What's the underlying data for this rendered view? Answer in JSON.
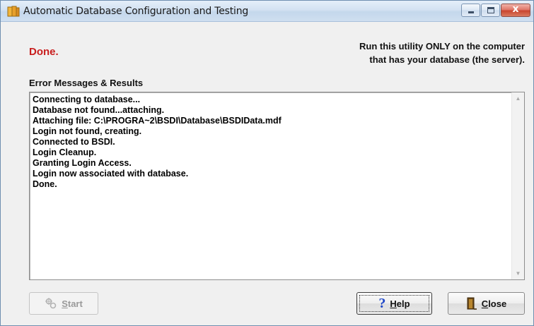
{
  "window": {
    "title": "Automatic Database Configuration and Testing",
    "icons": [
      "app-icon",
      "minimize-icon",
      "maximize-icon",
      "close-icon"
    ],
    "close_glyph": "x"
  },
  "status": {
    "text": "Done.",
    "color": "#c81e1e"
  },
  "notice": {
    "line1": "Run this utility ONLY on the computer",
    "line2": "that has your database (the server)."
  },
  "results": {
    "label": "Error Messages & Results",
    "lines": [
      "Connecting to database...",
      "Database not found...attaching.",
      "Attaching file: C:\\PROGRA~2\\BSDI\\Database\\BSDIData.mdf",
      "Login not found, creating.",
      "Connected to BSDI.",
      "Login Cleanup.",
      "Granting Login Access.",
      "Login now associated with database.",
      "Done."
    ]
  },
  "buttons": {
    "start": {
      "label": "Start",
      "accel": "S",
      "rest": "tart",
      "enabled": false,
      "icon": "start-icon"
    },
    "help": {
      "label": "Help",
      "accel": "H",
      "rest": "elp",
      "icon": "help-icon"
    },
    "close": {
      "label": "Close",
      "accel": "C",
      "rest": "lose",
      "icon": "close-door-icon"
    }
  }
}
